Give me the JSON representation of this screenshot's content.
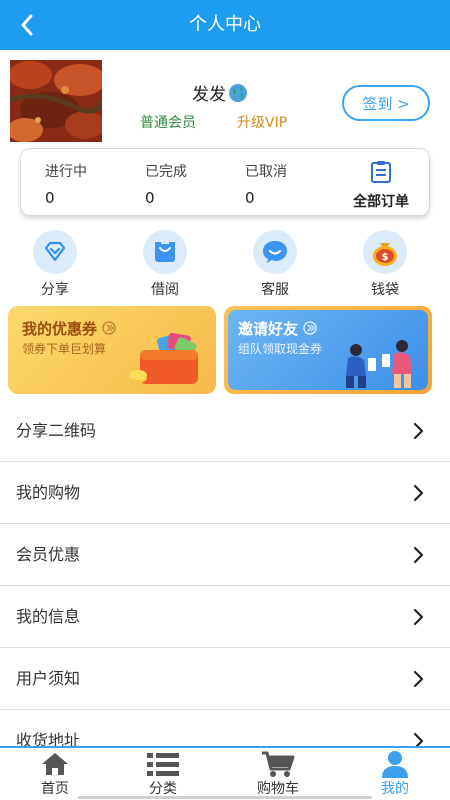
{
  "header": {
    "title": "个人中心"
  },
  "profile": {
    "nickname": "发发",
    "member_level": "普通会员",
    "upgrade_label": "升级VIP",
    "signin_label": "签到 >"
  },
  "orders": {
    "items": [
      {
        "label": "进行中",
        "count": "0"
      },
      {
        "label": "已完成",
        "count": "0"
      },
      {
        "label": "已取消",
        "count": "0"
      }
    ],
    "all_label": "全部订单"
  },
  "tools": [
    {
      "label": "分享",
      "icon": "share-icon"
    },
    {
      "label": "借阅",
      "icon": "bag-icon"
    },
    {
      "label": "客服",
      "icon": "chat-icon"
    },
    {
      "label": "钱袋",
      "icon": "money-bag-icon"
    }
  ],
  "promos": {
    "coupon": {
      "title": "我的优惠券",
      "subtitle": "领券下单巨划算"
    },
    "invite": {
      "title": "邀请好友",
      "subtitle": "组队领取现金券"
    }
  },
  "menu": [
    {
      "label": "分享二维码"
    },
    {
      "label": "我的购物"
    },
    {
      "label": "会员优惠"
    },
    {
      "label": "我的信息"
    },
    {
      "label": "用户须知"
    },
    {
      "label": "收货地址"
    }
  ],
  "tabbar": [
    {
      "label": "首页",
      "icon": "home-icon"
    },
    {
      "label": "分类",
      "icon": "list-icon"
    },
    {
      "label": "购物车",
      "icon": "cart-icon"
    },
    {
      "label": "我的",
      "icon": "user-icon",
      "active": true
    }
  ],
  "colors": {
    "primary": "#1e9df0",
    "accent_blue": "#3ea2f5",
    "member_green": "#2e8b3a",
    "vip_orange": "#d58a1c"
  }
}
